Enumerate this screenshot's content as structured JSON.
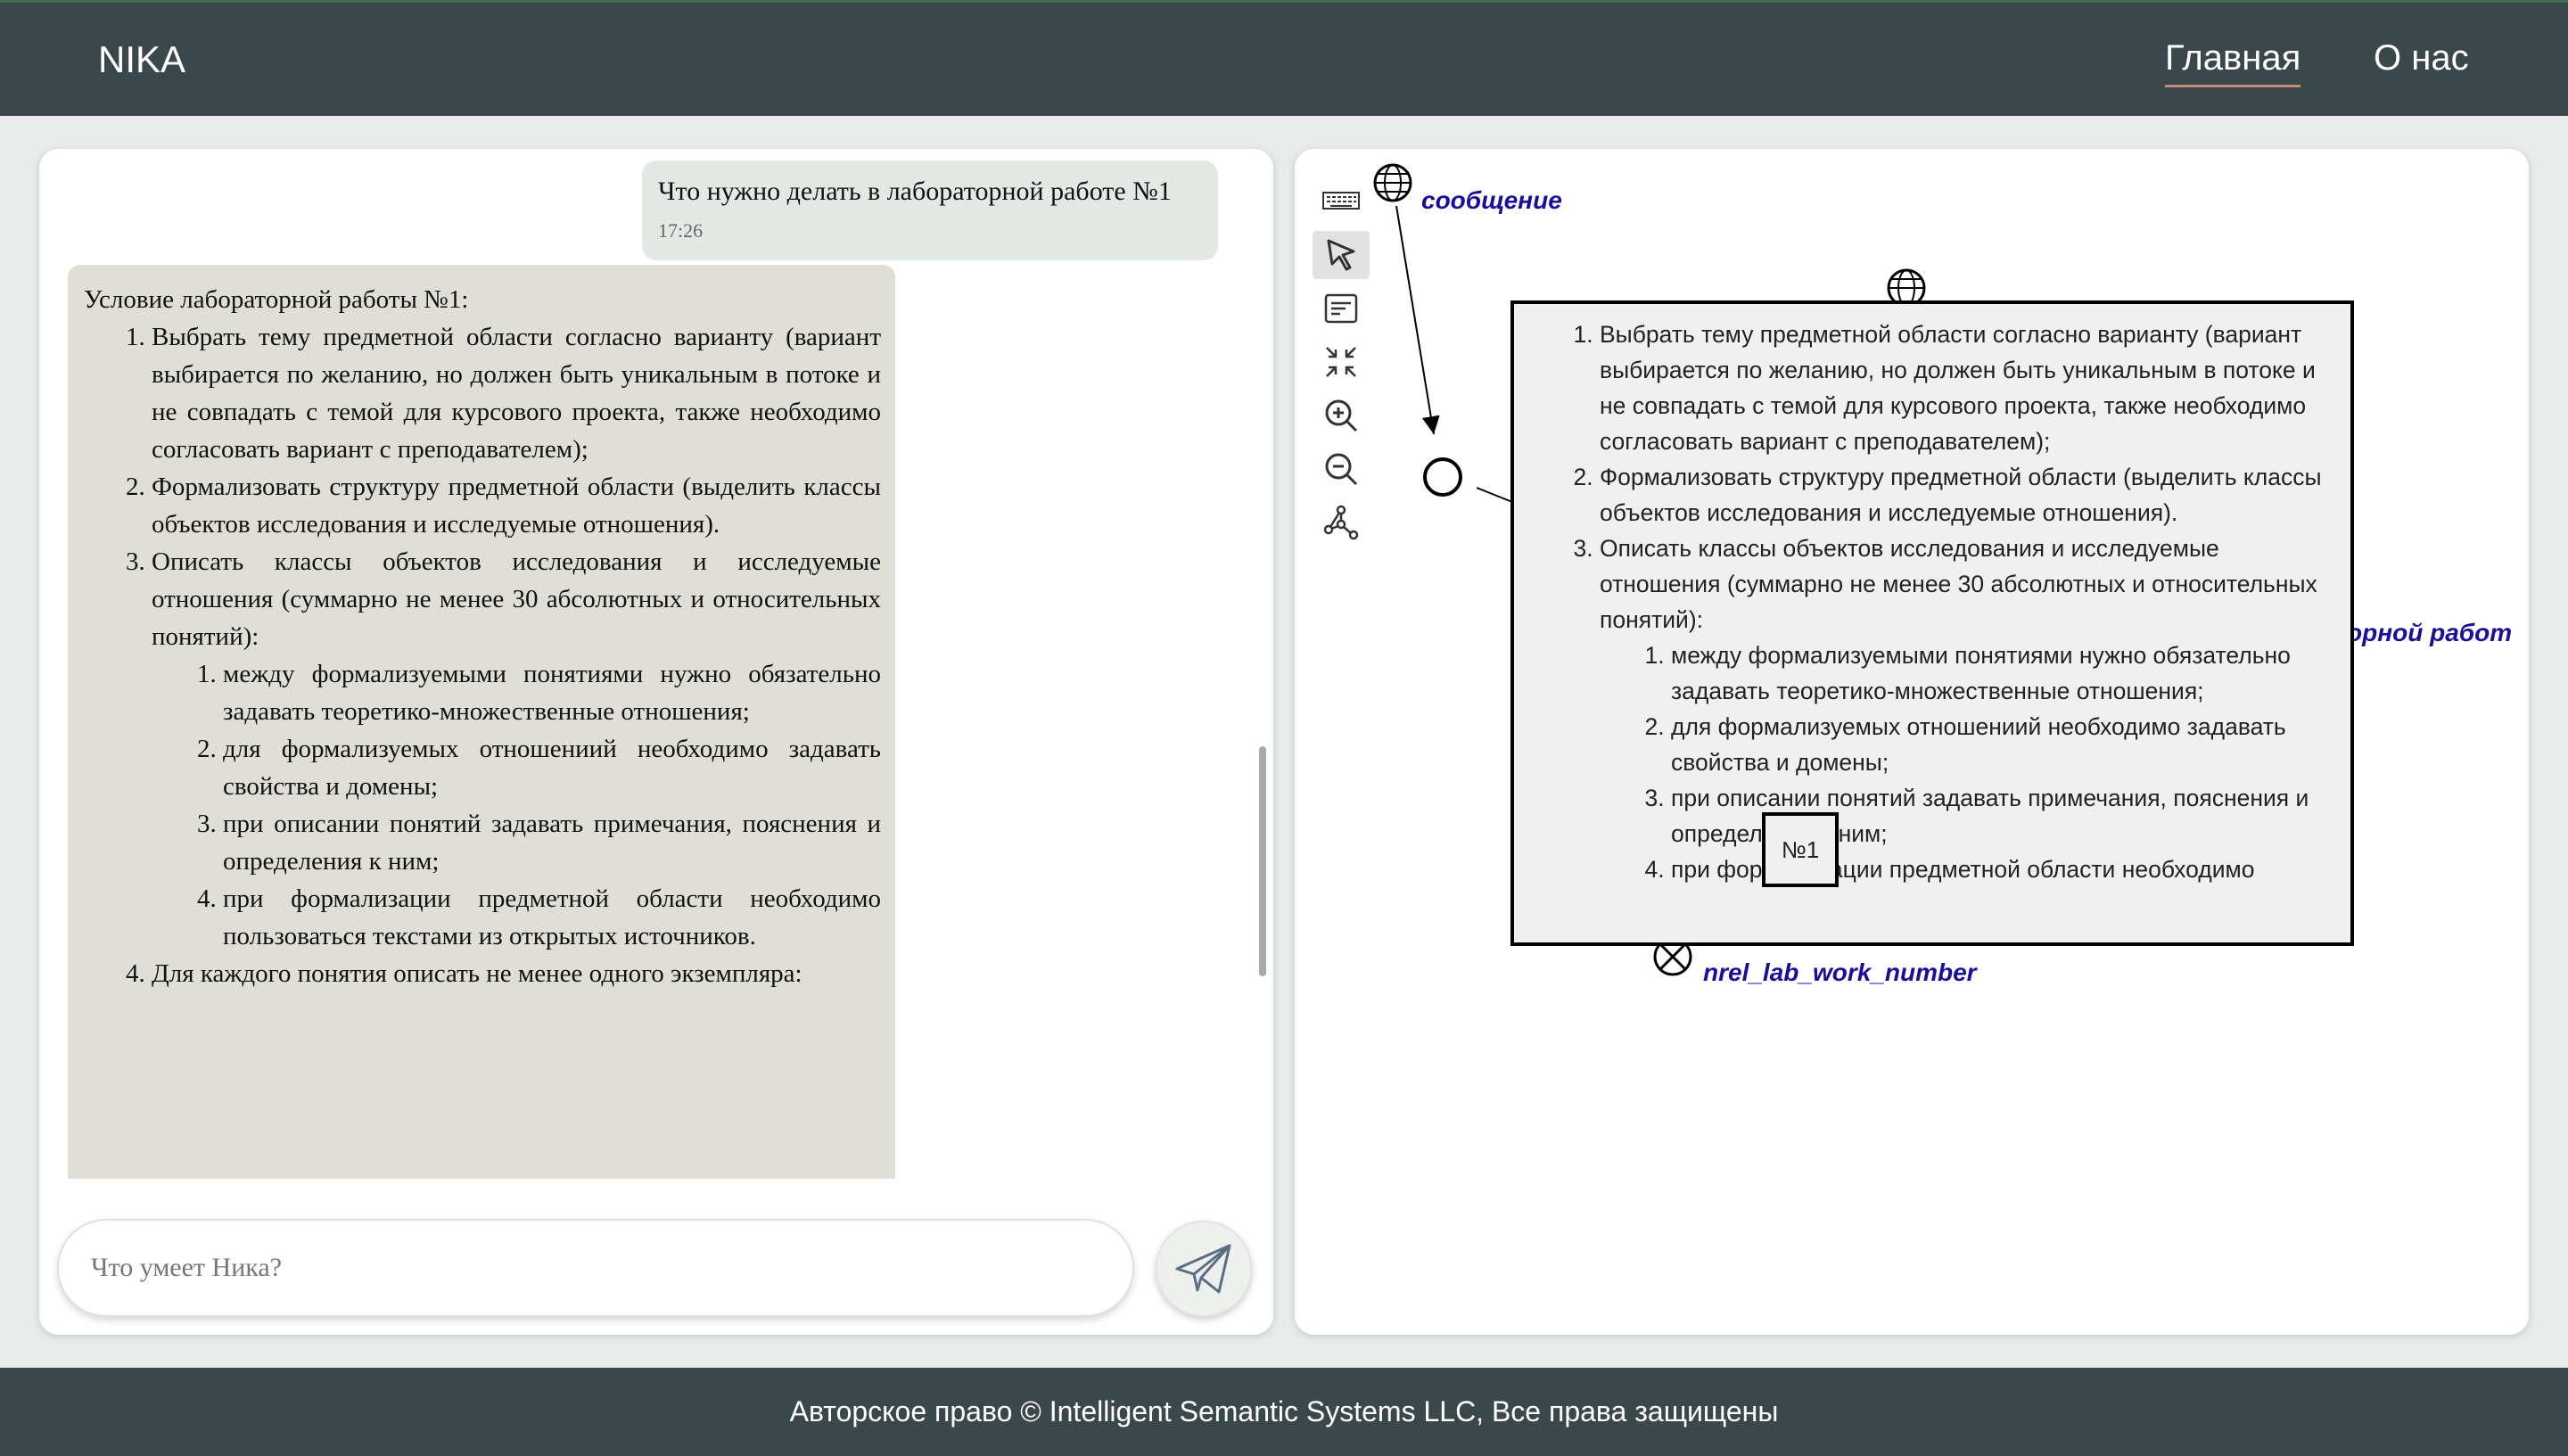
{
  "header": {
    "brand": "NIKA",
    "nav": {
      "home": "Главная",
      "about": "О нас"
    }
  },
  "chat": {
    "user_message": {
      "text": "Что нужно делать в лабораторной работе №1",
      "time": "17:26"
    },
    "bot_message": {
      "title": "Условие лабораторной работы №1:",
      "items": [
        "Выбрать тему предметной области согласно варианту (вариант выбирается по желанию, но должен быть уникальным в потоке и не совпадать с темой для курсового проекта, также необходимо согласовать вариант с преподавателем);",
        "Формализовать структуру предметной области (выделить классы объектов исследования и исследуемые отношения).",
        "Описать классы объектов исследования и исследуемые отношения (суммарно не менее 30 абсолютных и относительных понятий):",
        "Для каждого понятия описать не менее одного экземпляра:"
      ],
      "subitems": [
        "между формализуемыми понятиями нужно обязательно задавать теоретико-множественные отношения;",
        "для формализуемых отношениий необходимо задавать свойства и домены;",
        "при описании понятий задавать примечания, пояснения и определения к ним;",
        "при формализации предметной области необходимо пользоваться текстами из открытых источников."
      ]
    },
    "input": {
      "placeholder": "Что умеет Ника?"
    }
  },
  "graph": {
    "toolbar": [
      "keyboard-icon",
      "pointer-icon",
      "text-view-icon",
      "collapse-icon",
      "zoom-in-icon",
      "zoom-out-icon",
      "graph-layout-icon"
    ],
    "labels": {
      "message": "сообщение",
      "lab_work": "орной работ",
      "relation": "nrel_lab_work_number",
      "number": "№1"
    },
    "popup": {
      "items": [
        "Выбрать тему предметной области согласно варианту (вариант выбирается по желанию, но должен быть уникальным в потоке и не совпадать с темой для курсового проекта, также необходимо согласовать вариант с преподавателем);",
        "Формализовать структуру предметной области (выделить классы объектов исследования и исследуемые отношения).",
        "Описать классы объектов исследования и исследуемые отношения (суммарно не менее 30 абсолютных и относительных понятий):"
      ],
      "subitems": [
        "между формализуемыми понятиями нужно обязательно задавать теоретико-множественные отношения;",
        "для формализуемых отношениий необходимо задавать свойства и домены;",
        "при описании понятий задавать примечания, пояснения и определения к ним;",
        "при формализации предметной области необходимо"
      ]
    }
  },
  "footer": {
    "text": "Авторское право © Intelligent Semantic Systems LLC, Все права защищены"
  },
  "colors": {
    "header_bg": "#3a474b",
    "bot_bubble": "#e0dfd6",
    "user_bubble": "#e4e9e6",
    "graph_label": "#1a0f9c"
  }
}
